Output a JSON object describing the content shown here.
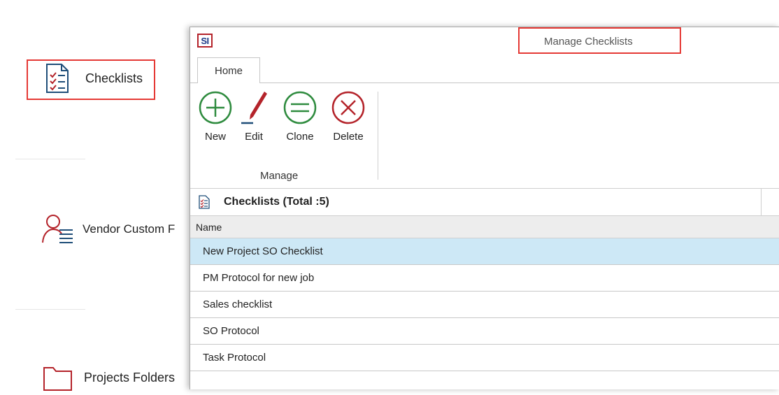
{
  "sidebar": {
    "items": [
      {
        "label": "Checklists",
        "icon": "checklist-icon"
      },
      {
        "label": "Vendor Custom F",
        "icon": "vendor-list-icon"
      },
      {
        "label": "Projects Folders",
        "icon": "folder-icon"
      }
    ]
  },
  "window": {
    "logo": "SI",
    "title": "Manage Checklists",
    "tabs": [
      {
        "label": "Home"
      }
    ],
    "ribbon": {
      "group_label": "Manage",
      "buttons": [
        {
          "label": "New",
          "icon": "plus-circle-icon"
        },
        {
          "label": "Edit",
          "icon": "pen-icon"
        },
        {
          "label": "Clone",
          "icon": "equals-circle-icon"
        },
        {
          "label": "Delete",
          "icon": "x-circle-icon"
        }
      ]
    },
    "list": {
      "header": "Checklists (Total :5)",
      "column": "Name",
      "rows": [
        "New Project SO Checklist",
        "PM Protocol for new job",
        "Sales checklist",
        "SO Protocol",
        "Task Protocol"
      ],
      "selected_index": 0
    }
  },
  "colors": {
    "highlight": "#e53935",
    "accent_red": "#b4232a",
    "accent_green": "#2e8b3e",
    "accent_blue": "#1f3c88",
    "selection": "#cde8f6"
  }
}
